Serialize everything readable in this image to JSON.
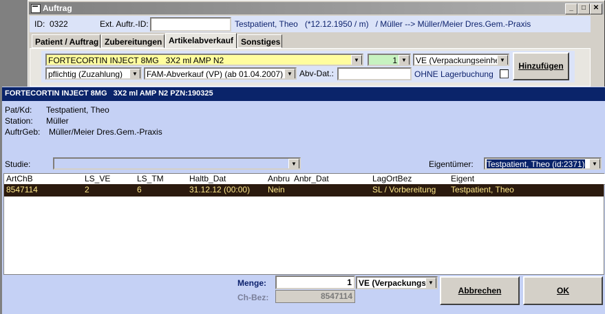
{
  "window": {
    "title": "Auftrag"
  },
  "header": {
    "id_label": "ID:",
    "id_value": "0322",
    "ext_label": "Ext. Auftr.-ID:",
    "ext_value": "",
    "patient_text": "Testpatient, Theo   (*12.12.1950 / m)   / Müller --> Müller/Meier Dres.Gem.-Praxis"
  },
  "tabs": [
    {
      "label": "Patient / Auftrag"
    },
    {
      "label": "Zubereitungen"
    },
    {
      "label": "Artikelabverkauf"
    },
    {
      "label": "Sonstiges"
    }
  ],
  "article_form": {
    "article": "FORTECORTIN INJECT 8MG   3X2 ml AMP N2",
    "quantity": "1",
    "unit": "VE (Verpackungseinheit)",
    "copay": "pflichtig (Zuzahlung)",
    "sale_type": "FAM-Abverkauf (VP) (ab 01.04.2007)",
    "abv_label": "Abv-Dat.:",
    "abv_value": "",
    "no_stock_label": "OHNE Lagerbuchung",
    "add_button": "Hinzufügen"
  },
  "dialog": {
    "title": "FORTECORTIN INJECT 8MG   3X2 ml AMP N2 PZN:190325",
    "pat_label": "Pat/Kd:",
    "pat_value": "Testpatient, Theo",
    "station_label": "Station:",
    "station_value": "Müller",
    "auftrgeb_label": "AuftrGeb:",
    "auftrgeb_value": "Müller/Meier Dres.Gem.-Praxis",
    "studie_label": "Studie:",
    "studie_value": "",
    "owner_label": "Eigentümer:",
    "owner_value": "Testpatient, Theo (id:2371)",
    "grid_headers": [
      "ArtChB",
      "LS_VE",
      "LS_TM",
      "Haltb_Dat",
      "Anbru",
      "Anbr_Dat",
      "LagOrtBez",
      "Eigent"
    ],
    "grid_rows": [
      [
        "8547114",
        "2",
        "6",
        "31.12.12 (00:00)",
        "Nein",
        "",
        "SL / Vorbereitung",
        "Testpatient, Theo"
      ]
    ],
    "menge_label": "Menge:",
    "menge_value": "1",
    "menge_unit": "VE (Verpackungseinheit)",
    "chbez_label": "Ch-Bez:",
    "chbez_value": "8547114",
    "cancel_button": "Abbrechen",
    "ok_button": "OK"
  }
}
